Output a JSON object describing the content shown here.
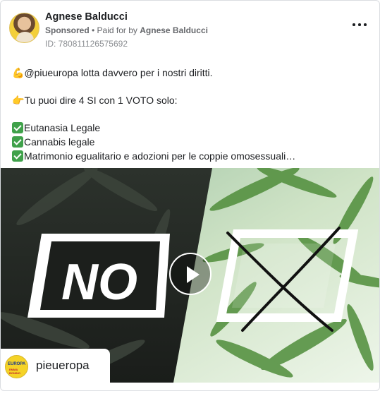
{
  "post": {
    "author": "Agnese Balducci",
    "sponsored": "Sponsored",
    "separator": " • ",
    "paid_for_prefix": "Paid for by ",
    "paid_for_name": "Agnese Balducci",
    "ad_id": "ID: 780811126575692",
    "menu_icon": "more-horizontal-icon"
  },
  "text": {
    "line1": "@piueuropa lotta davvero per i nostri diritti.",
    "line2": "Tu puoi dire 4 SI con 1 VOTO solo:",
    "items": [
      "Eutanasia Legale",
      "Cannabis legale",
      "Matrimonio egualitario e adozioni per le coppie omosessuali…"
    ],
    "emoji_line1": "flexed-biceps-icon",
    "emoji_line2": "pointing-right-icon",
    "emoji_items": "check-mark-icon"
  },
  "media": {
    "left_word": "NO",
    "play_icon": "play-icon",
    "cross_icon": "x-mark-icon",
    "badge_name": "pieueropa",
    "badge_logo_top": "EUROPA",
    "badge_logo_bottom": "EMMA BONINO"
  },
  "colors": {
    "check": "#3fa14a",
    "text": "#1c1e21",
    "muted": "#65676b"
  }
}
